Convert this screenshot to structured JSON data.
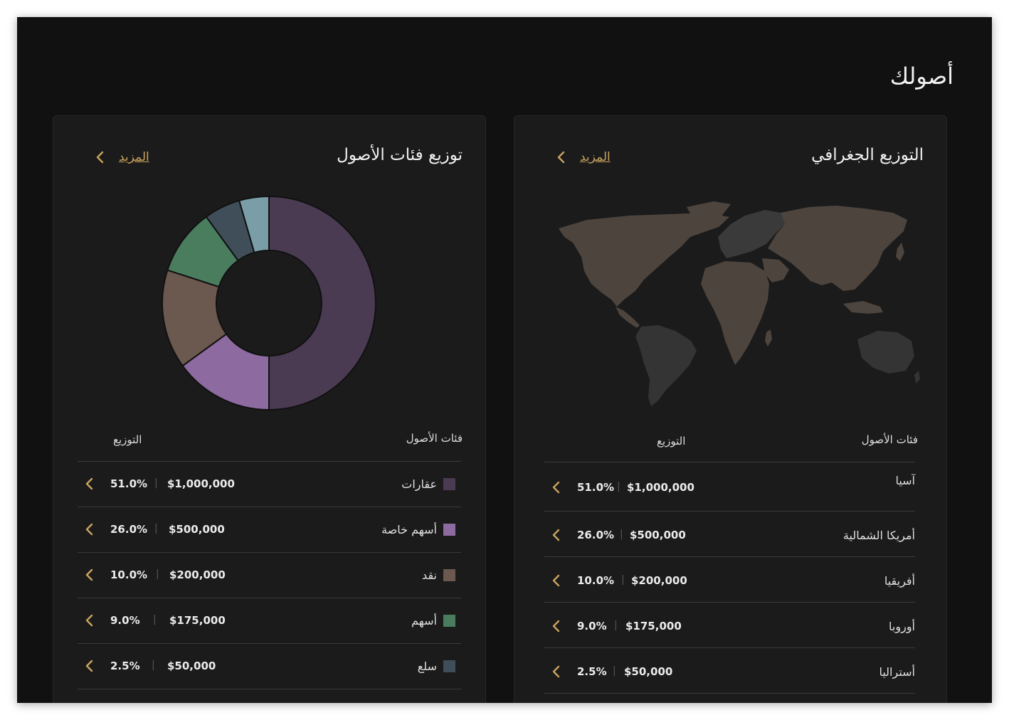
{
  "page": {
    "title": "أصولك"
  },
  "asset_card": {
    "title": "توزيع فئات الأصول",
    "more_label": "المزيد",
    "col_category": "فئات الأصول",
    "col_distribution": "التوزيع",
    "rows": [
      {
        "name": "عقارات",
        "amount": "$1,000,000",
        "percent": "51.0%",
        "color": "#4a3a52"
      },
      {
        "name": "أسهم خاصة",
        "amount": "$500,000",
        "percent": "26.0%",
        "color": "#8d6a9f"
      },
      {
        "name": "نقد",
        "amount": "$200,000",
        "percent": "10.0%",
        "color": "#6b584e"
      },
      {
        "name": "أسهم",
        "amount": "$175,000",
        "percent": "9.0%",
        "color": "#4a7d5e"
      },
      {
        "name": "سلع",
        "amount": "$50,000",
        "percent": "2.5%",
        "color": "#3f4e58"
      }
    ]
  },
  "geo_card": {
    "title": "التوزيع الجغرافي",
    "more_label": "المزيد",
    "col_category": "فئات الأصول",
    "col_distribution": "التوزيع",
    "rows": [
      {
        "name": "آسيا",
        "amount": "$1,000,000",
        "percent": "51.0%"
      },
      {
        "name": "أمريكا الشمالية",
        "amount": "$500,000",
        "percent": "26.0%"
      },
      {
        "name": "أفريقيا",
        "amount": "$200,000",
        "percent": "10.0%"
      },
      {
        "name": "أوروبا",
        "amount": "$175,000",
        "percent": "9.0%"
      },
      {
        "name": "أستراليا",
        "amount": "$50,000",
        "percent": "2.5%"
      }
    ]
  },
  "chart_data": {
    "type": "pie",
    "donut": true,
    "categories": [
      "عقارات",
      "أسهم خاصة",
      "نقد",
      "أسهم",
      "سلع",
      ""
    ],
    "values": [
      50,
      15,
      15,
      10,
      5.5,
      4.5
    ],
    "colors": [
      "#4a3a52",
      "#8d6a9f",
      "#6b584e",
      "#4a7d5e",
      "#3f4e58",
      "#7a9ea8"
    ]
  },
  "colors": {
    "accent": "#c9a45e",
    "background": "#111111",
    "card": "#1b1b1b",
    "map_land": "#4d443e",
    "map_land_dark": "#3a3a3a"
  },
  "icons": {
    "more": "chevron-left-icon",
    "row_action": "chevron-left-icon"
  }
}
